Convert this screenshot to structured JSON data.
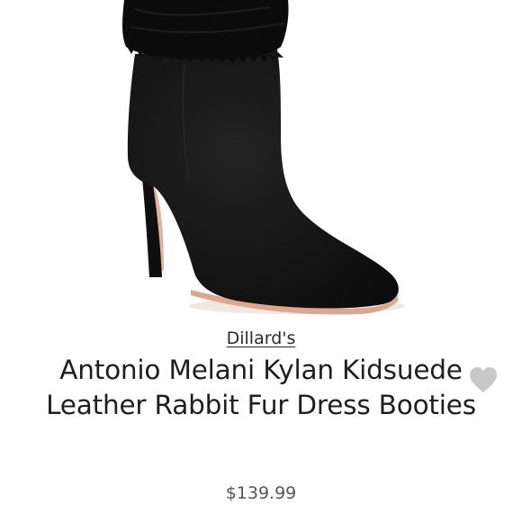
{
  "product": {
    "image_alt": "Black suede ankle bootie with rabbit fur cuff",
    "brand": "Dillard's",
    "title": "Antonio Melani Kylan Kidsuede Leather Rabbit Fur Dress Booties",
    "price": "$139.99",
    "favorite_icon": "heart-icon"
  },
  "colors": {
    "boot": "#141414",
    "fur": "#0d0d0d",
    "heel_lining": "#e3b29b",
    "heart": "#c8c8c8"
  }
}
